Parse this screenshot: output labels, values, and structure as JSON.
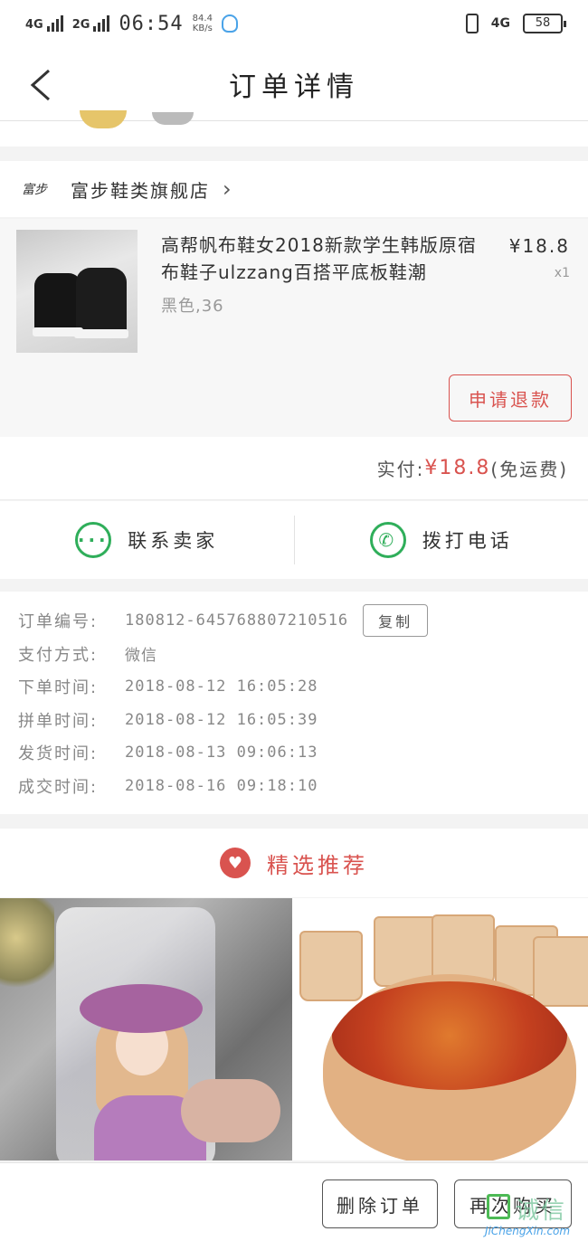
{
  "status_bar": {
    "signal1": "4G",
    "signal2": "2G",
    "time": "06:54",
    "speed_value": "84.4",
    "speed_unit": "KB/s",
    "network": "4G",
    "battery": "58"
  },
  "header": {
    "title": "订单详情"
  },
  "store": {
    "logo_text": "富步",
    "name": "富步鞋类旗舰店",
    "chevron": "›"
  },
  "product": {
    "title": "高帮帆布鞋女2018新款学生韩版原宿布鞋子ulzzang百搭平底板鞋潮",
    "spec": "黑色,36",
    "price": "¥18.8",
    "quantity": "x1"
  },
  "actions": {
    "refund_label": "申请退款"
  },
  "payment": {
    "label": "实付:",
    "amount": "¥18.8",
    "note": "(免运费)"
  },
  "contact": {
    "seller_label": "联系卖家",
    "call_label": "拨打电话"
  },
  "order_info": {
    "rows": [
      {
        "label": "订单编号:",
        "value": "180812-645768807210516"
      },
      {
        "label": "支付方式:",
        "value": "微信"
      },
      {
        "label": "下单时间:",
        "value": "2018-08-12 16:05:28"
      },
      {
        "label": "拼单时间:",
        "value": "2018-08-12 16:05:39"
      },
      {
        "label": "发货时间:",
        "value": "2018-08-13 09:06:13"
      },
      {
        "label": "成交时间:",
        "value": "2018-08-16 09:18:10"
      }
    ],
    "copy_label": "复制"
  },
  "recommend": {
    "title": "精选推荐"
  },
  "bottom": {
    "delete_label": "删除订单",
    "rebuy_label": "再次购买"
  },
  "watermark": {
    "text": "诚信",
    "url": "JiChengXin.com"
  },
  "colors": {
    "accent_red": "#d9534f",
    "wechat_green": "#2fae5a",
    "background": "#f3f3f3"
  },
  "icons": {
    "back": "chevron-left-icon",
    "chat": "chat-bubble-icon",
    "phone": "phone-icon",
    "heart": "heart-icon"
  }
}
